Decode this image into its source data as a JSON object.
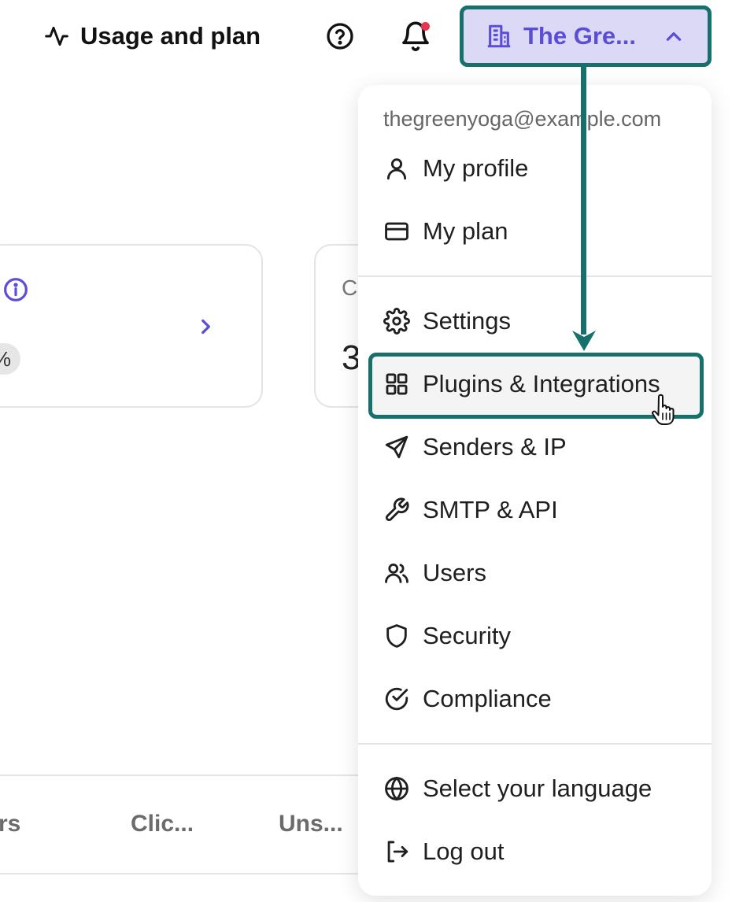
{
  "header": {
    "usage_label": "Usage and plan",
    "account_name": "The Gre...",
    "icons": {
      "usage": "activity-icon",
      "help": "help-circle-icon",
      "bell": "bell-icon",
      "account": "building-icon",
      "chevron": "chevron-up-icon"
    }
  },
  "background": {
    "card1_percent": "%",
    "card2_label": "C",
    "card2_value": "3",
    "columns": [
      "rs",
      "Clic...",
      "Uns..."
    ]
  },
  "menu": {
    "email": "thegreenyoga@example.com",
    "items": [
      {
        "label": "My profile",
        "icon": "user-icon"
      },
      {
        "label": "My plan",
        "icon": "credit-card-icon"
      },
      {
        "label": "Settings",
        "icon": "gear-icon"
      },
      {
        "label": "Plugins & Integrations",
        "icon": "grid-icon"
      },
      {
        "label": "Senders & IP",
        "icon": "send-icon"
      },
      {
        "label": "SMTP & API",
        "icon": "wrench-icon"
      },
      {
        "label": "Users",
        "icon": "users-icon"
      },
      {
        "label": "Security",
        "icon": "shield-icon"
      },
      {
        "label": "Compliance",
        "icon": "check-circle-icon"
      },
      {
        "label": "Select your language",
        "icon": "globe-icon"
      },
      {
        "label": "Log out",
        "icon": "logout-icon"
      }
    ],
    "highlighted_item": "Plugins & Integrations"
  },
  "colors": {
    "accent": "#5b4ed6",
    "account_bg": "#dcd9f6",
    "annotation": "#17706b",
    "notification_dot": "#e8344f"
  }
}
